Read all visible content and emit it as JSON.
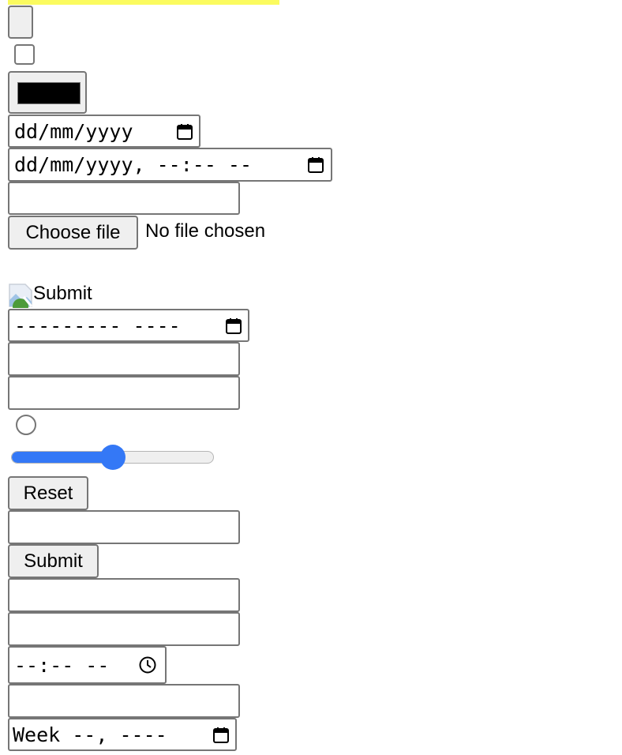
{
  "colors": {
    "highlight": "#fbfb5f",
    "accent": "#3478f6",
    "border": "#767676",
    "button_bg": "#efefef",
    "swatch": "#000000"
  },
  "form": {
    "color_value": "#000000",
    "date_placeholder": "dd/mm/yyyy",
    "datetime_placeholder": "dd/mm/yyyy, --:-- --",
    "file_button_label": "Choose file",
    "file_status": "No file chosen",
    "image_submit_alt": "Submit",
    "month_placeholder": "--------- ----",
    "range_value_percent": 50,
    "reset_label": "Reset",
    "submit_label": "Submit",
    "time_placeholder": "--:-- --",
    "week_placeholder": "Week --, ----"
  },
  "icons": {
    "calendar": "calendar-icon",
    "clock": "clock-icon",
    "broken_image": "broken-image-icon"
  }
}
